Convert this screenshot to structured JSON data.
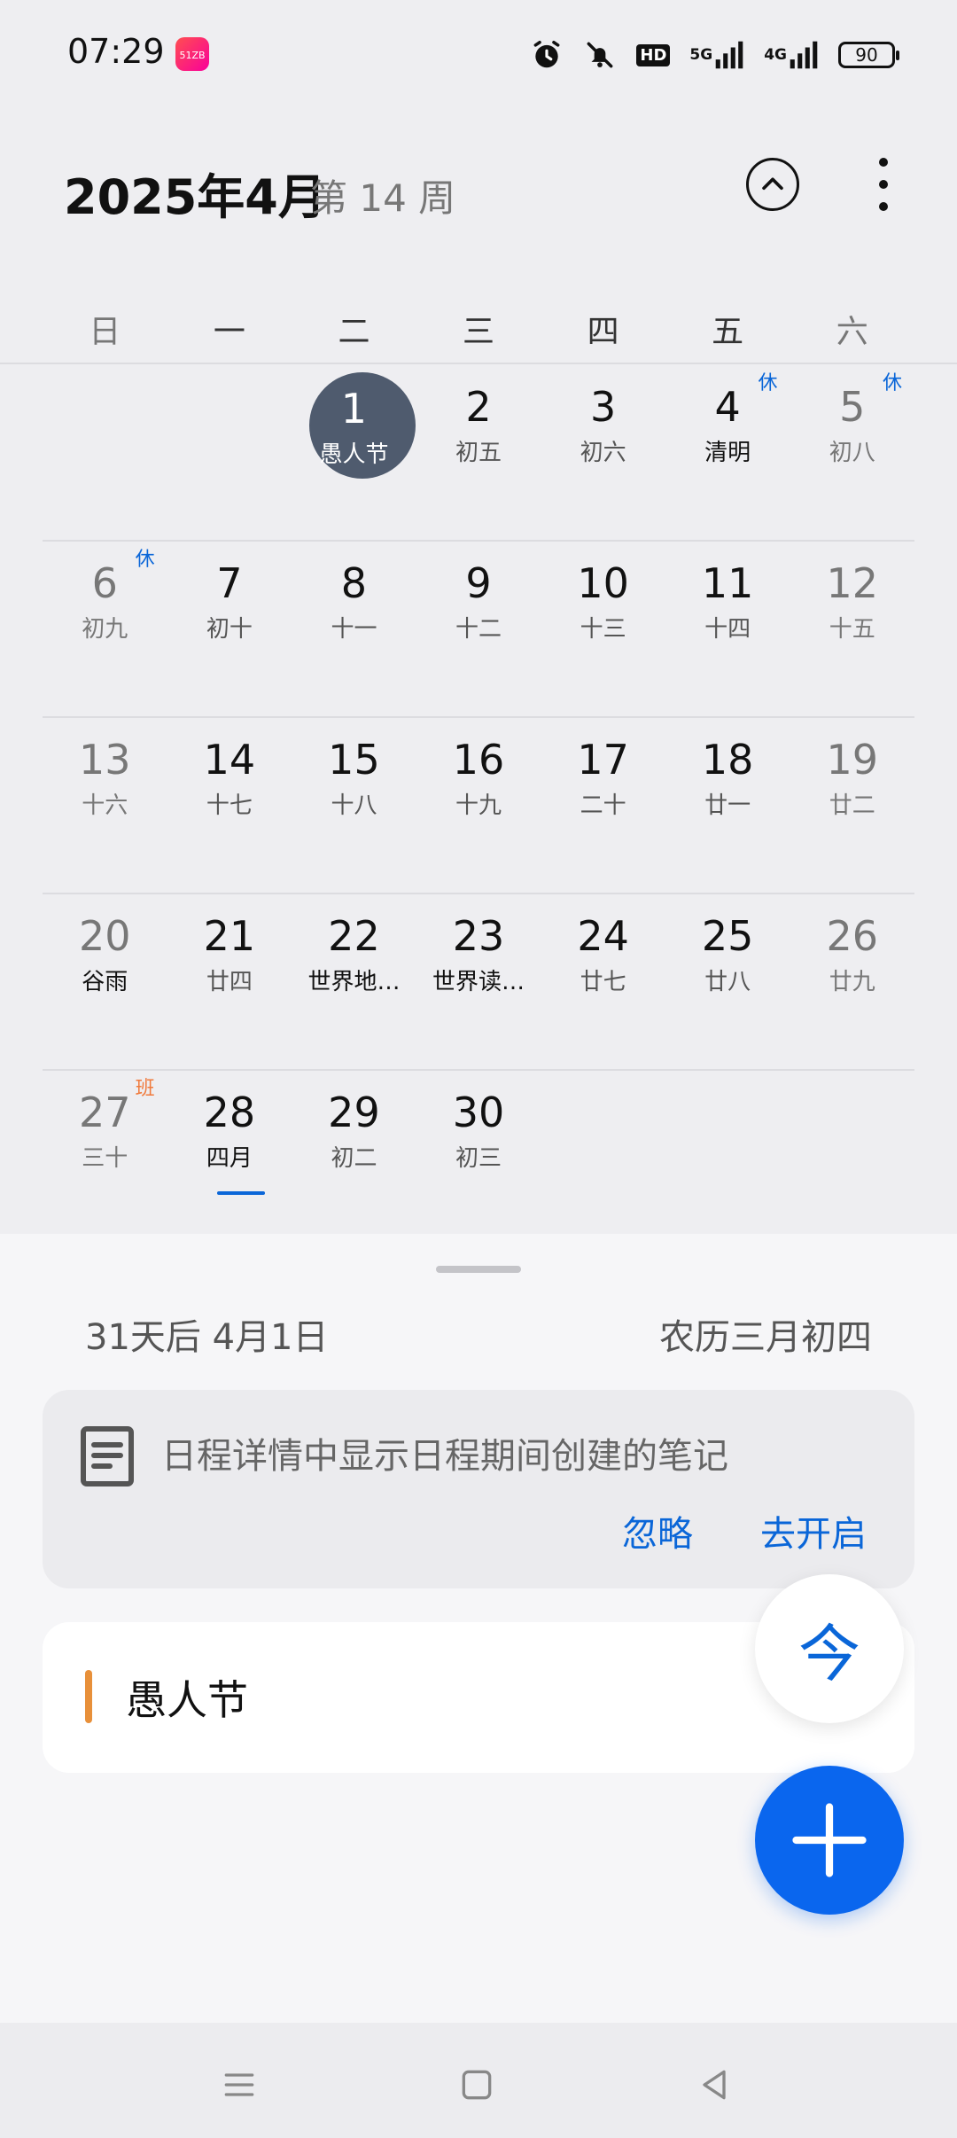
{
  "status_bar": {
    "time": "07:29",
    "app_badge_text": "51ZB",
    "signal_5g": "5G",
    "signal_4g": "4G",
    "hd": "HD",
    "battery": "90"
  },
  "header": {
    "title": "2025年4月",
    "week": "第 14 周"
  },
  "weekdays": [
    "日",
    "一",
    "二",
    "三",
    "四",
    "五",
    "六"
  ],
  "calendar": {
    "rows": [
      [
        {
          "num": "",
          "lunar": ""
        },
        {
          "num": "",
          "lunar": ""
        },
        {
          "num": "1",
          "lunar": "愚人节"
        },
        {
          "num": "2",
          "lunar": "初五"
        },
        {
          "num": "3",
          "lunar": "初六"
        },
        {
          "num": "4",
          "lunar": "清明",
          "tag": "休"
        },
        {
          "num": "5",
          "lunar": "初八",
          "tag": "休"
        }
      ],
      [
        {
          "num": "6",
          "lunar": "初九",
          "tag": "休"
        },
        {
          "num": "7",
          "lunar": "初十"
        },
        {
          "num": "8",
          "lunar": "十一"
        },
        {
          "num": "9",
          "lunar": "十二"
        },
        {
          "num": "10",
          "lunar": "十三"
        },
        {
          "num": "11",
          "lunar": "十四"
        },
        {
          "num": "12",
          "lunar": "十五"
        }
      ],
      [
        {
          "num": "13",
          "lunar": "十六"
        },
        {
          "num": "14",
          "lunar": "十七"
        },
        {
          "num": "15",
          "lunar": "十八"
        },
        {
          "num": "16",
          "lunar": "十九"
        },
        {
          "num": "17",
          "lunar": "二十"
        },
        {
          "num": "18",
          "lunar": "廿一"
        },
        {
          "num": "19",
          "lunar": "廿二"
        }
      ],
      [
        {
          "num": "20",
          "lunar": "谷雨"
        },
        {
          "num": "21",
          "lunar": "廿四"
        },
        {
          "num": "22",
          "lunar": "世界地…"
        },
        {
          "num": "23",
          "lunar": "世界读…"
        },
        {
          "num": "24",
          "lunar": "廿七"
        },
        {
          "num": "25",
          "lunar": "廿八"
        },
        {
          "num": "26",
          "lunar": "廿九"
        }
      ],
      [
        {
          "num": "27",
          "lunar": "三十",
          "tag": "班"
        },
        {
          "num": "28",
          "lunar": "四月"
        },
        {
          "num": "29",
          "lunar": "初二"
        },
        {
          "num": "30",
          "lunar": "初三"
        },
        {
          "num": "",
          "lunar": ""
        },
        {
          "num": "",
          "lunar": ""
        },
        {
          "num": "",
          "lunar": ""
        }
      ]
    ]
  },
  "sheet": {
    "day_info": "31天后  4月1日",
    "lunar_info": "农历三月初四",
    "notice_text": "日程详情中显示日程期间创建的笔记",
    "ignore_label": "忽略",
    "enable_label": "去开启",
    "event_title": "愚人节",
    "event_color": "#e8903a"
  },
  "fab": {
    "today_label": "今"
  },
  "colors": {
    "accent": "#0a66d8",
    "holiday_tag": "#0a66d8",
    "work_tag": "#f07a3c",
    "selected_bubble": "#4f5b6e"
  }
}
